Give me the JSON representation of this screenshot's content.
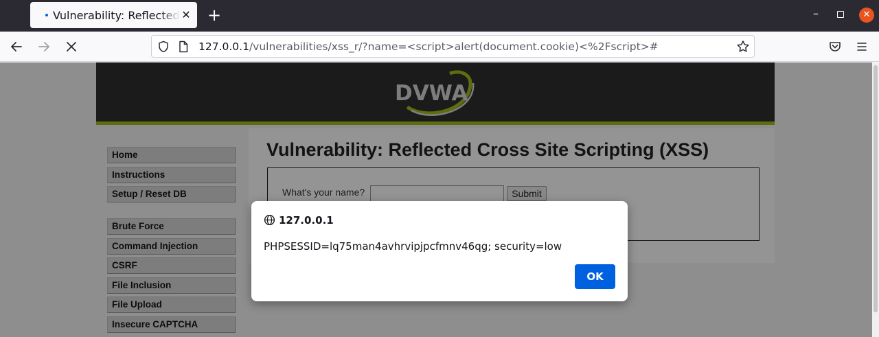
{
  "browser": {
    "tab_title": "Vulnerability: Reflected Cross Site Scripting (XSS) :: Damn Vulnerable Web Application (DVWA)",
    "tab_close": "✕",
    "new_tab": "+",
    "url_host": "127.0.0.1",
    "url_path": "/vulnerabilities/xss_r/?name=<script>alert(document.cookie)<%2Fscript>#",
    "accent_color": "#0061e0",
    "window_buttons": {
      "minimize": "–",
      "close": "✕"
    }
  },
  "dvwa": {
    "logo_text": "DVWA",
    "menu": [
      {
        "label": "Home"
      },
      {
        "label": "Instructions"
      },
      {
        "label": "Setup / Reset DB"
      },
      {
        "label": "Brute Force"
      },
      {
        "label": "Command Injection"
      },
      {
        "label": "CSRF"
      },
      {
        "label": "File Inclusion"
      },
      {
        "label": "File Upload"
      },
      {
        "label": "Insecure CAPTCHA"
      }
    ],
    "title": "Vulnerability: Reflected Cross Site Scripting (XSS)",
    "form_label": "What's your name?",
    "input_value": "",
    "submit_label": "Submit",
    "header_accent": "#a0bc1c"
  },
  "dialog": {
    "origin": "127.0.0.1",
    "message": "PHPSESSID=lq75man4avhrvipjpcfmnv46qg; security=low",
    "ok_label": "OK"
  }
}
